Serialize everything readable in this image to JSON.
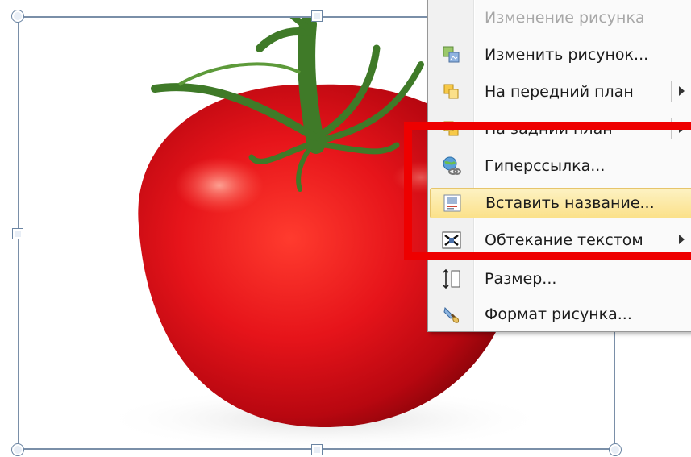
{
  "menu": {
    "header": "Изменение рисунка",
    "items": [
      {
        "label": "Изменить рисунок...",
        "icon": "change-picture-icon"
      },
      {
        "label": "На передний план",
        "icon": "bring-to-front-icon",
        "submenu": true
      },
      {
        "label": "На задний план",
        "icon": "send-to-back-icon",
        "submenu": true
      },
      {
        "label": "Гиперссылка...",
        "icon": "hyperlink-icon"
      },
      {
        "label": "Вставить название...",
        "icon": "insert-caption-icon",
        "highlighted": true
      },
      {
        "label": "Обтекание текстом",
        "icon": "text-wrapping-icon",
        "submenu": true
      },
      {
        "label": "Размер...",
        "icon": "size-icon"
      },
      {
        "label": "Формат рисунка...",
        "icon": "format-picture-icon"
      }
    ]
  },
  "colors": {
    "highlight_box": "#ee0000",
    "tomato": "#e01414",
    "stem": "#3f7a28",
    "hover_bg": "#fbe18a"
  }
}
